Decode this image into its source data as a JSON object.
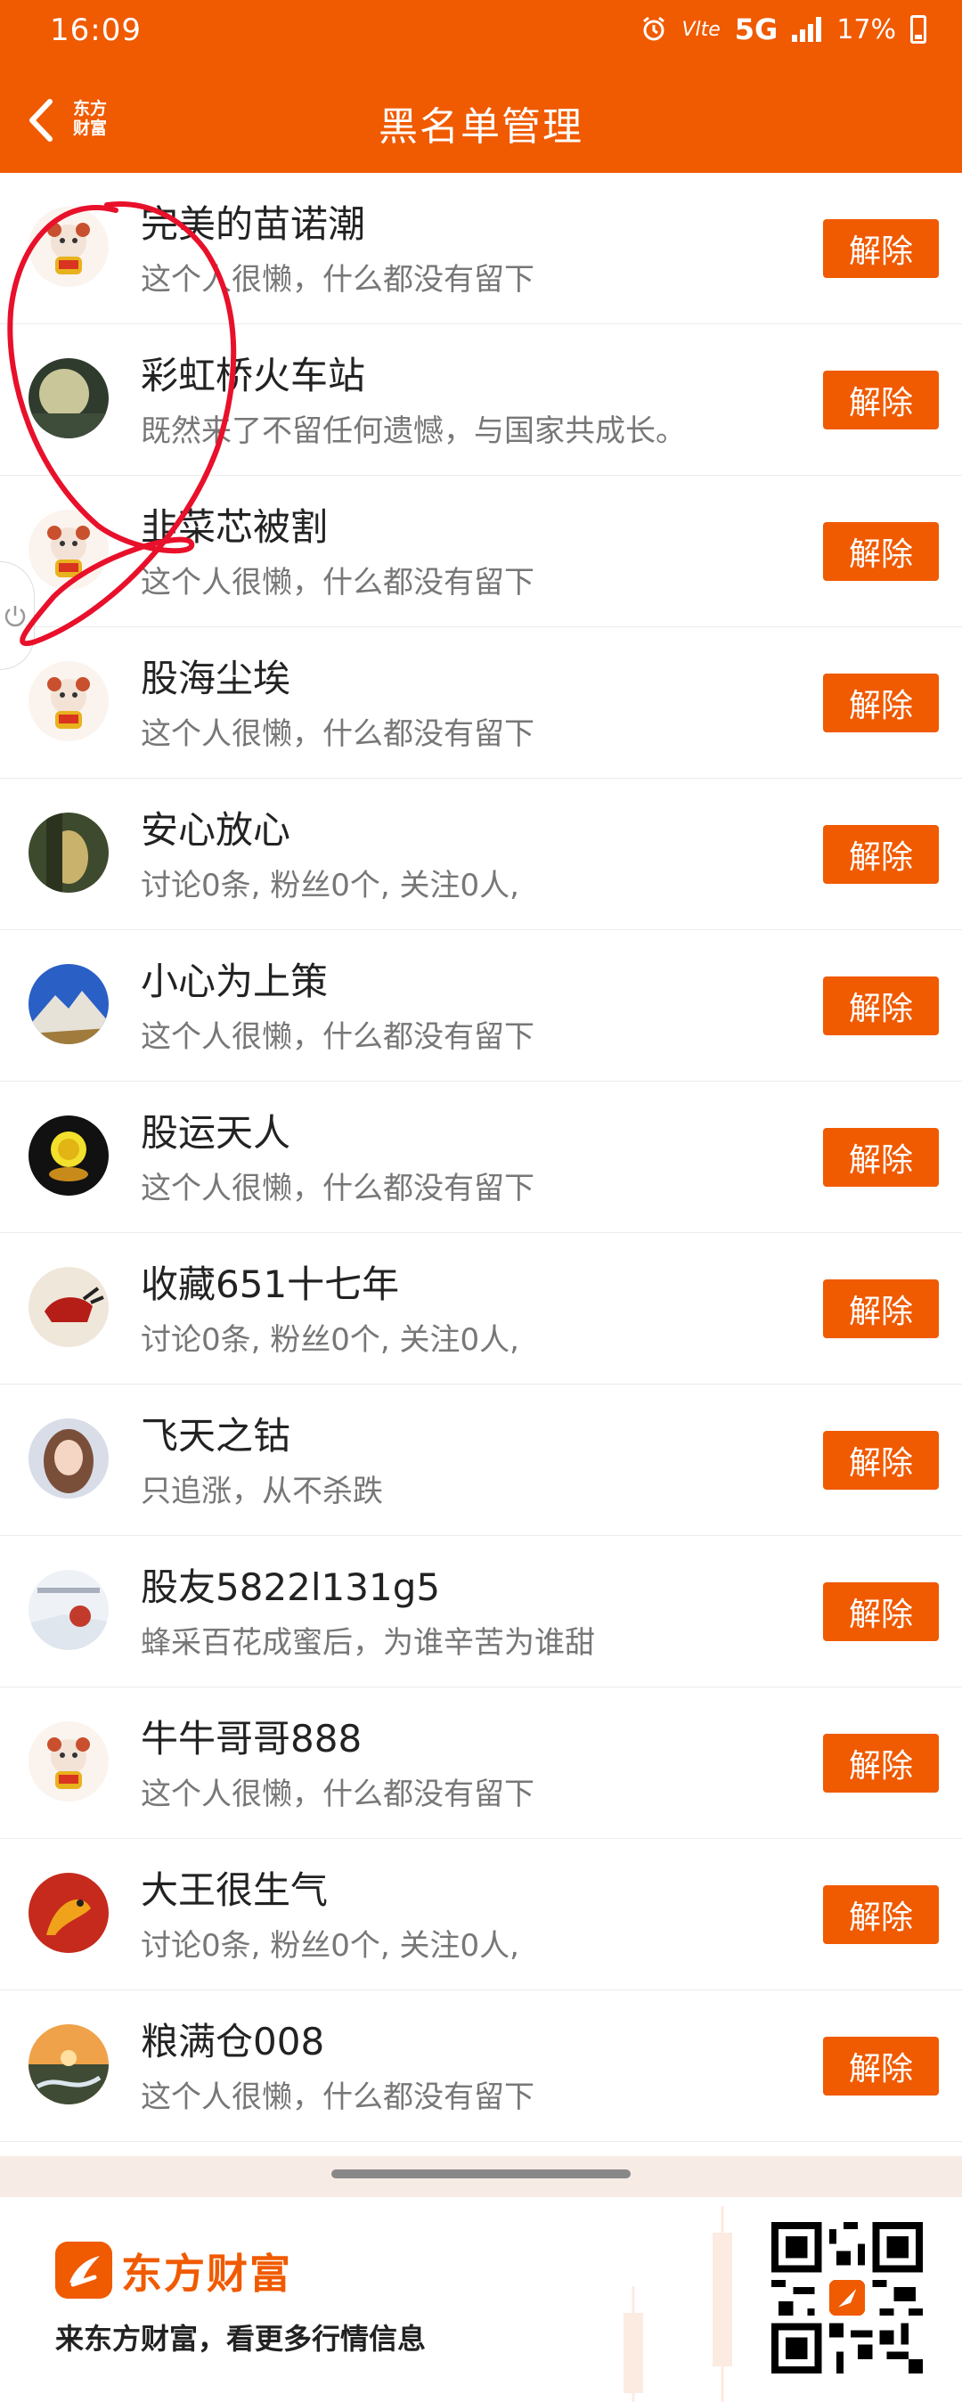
{
  "status_bar": {
    "time": "16:09",
    "volte": "Vlte",
    "network": "5G",
    "battery": "17%"
  },
  "nav": {
    "back_icon": "chevron-left-icon",
    "logo_text": [
      "东方",
      "财富"
    ],
    "title": "黑名单管理"
  },
  "blacklist": [
    {
      "name": "完美的苗诺潮",
      "desc": "这个人很懒，什么都没有留下",
      "button": "解除",
      "avatar": "mascot"
    },
    {
      "name": "彩虹桥火车站",
      "desc": "既然来了不留任何遗憾，与国家共成长。",
      "button": "解除",
      "avatar": "moon"
    },
    {
      "name": "韭菜芯被割",
      "desc": "这个人很懒，什么都没有留下",
      "button": "解除",
      "avatar": "mascot"
    },
    {
      "name": "股海尘埃",
      "desc": "这个人很懒，什么都没有留下",
      "button": "解除",
      "avatar": "mascot"
    },
    {
      "name": "安心放心",
      "desc": "讨论0条, 粉丝0个, 关注0人,",
      "button": "解除",
      "avatar": "cave"
    },
    {
      "name": "小心为上策",
      "desc": "这个人很懒，什么都没有留下",
      "button": "解除",
      "avatar": "mountain"
    },
    {
      "name": "股运天人",
      "desc": "这个人很懒，什么都没有留下",
      "button": "解除",
      "avatar": "gold"
    },
    {
      "name": "收藏651十七年",
      "desc": "讨论0条, 粉丝0个, 关注0人,",
      "button": "解除",
      "avatar": "bull"
    },
    {
      "name": "飞天之钴",
      "desc": "只追涨，从不杀跌",
      "button": "解除",
      "avatar": "girl"
    },
    {
      "name": "股友5822l131g5",
      "desc": "蜂采百花成蜜后，为谁辛苦为谁甜",
      "button": "解除",
      "avatar": "snow"
    },
    {
      "name": "牛牛哥哥888",
      "desc": "这个人很懒，什么都没有留下",
      "button": "解除",
      "avatar": "mascot"
    },
    {
      "name": "大王很生气",
      "desc": "讨论0条, 粉丝0个, 关注0人,",
      "button": "解除",
      "avatar": "dragon"
    },
    {
      "name": "粮满仓008",
      "desc": "这个人很懒，什么都没有留下",
      "button": "解除",
      "avatar": "sunset"
    }
  ],
  "footer": {
    "brand": "东方财富",
    "slogan": "来东方财富，看更多行情信息"
  },
  "colors": {
    "accent": "#f05a00",
    "scribble": "#e8102a"
  }
}
